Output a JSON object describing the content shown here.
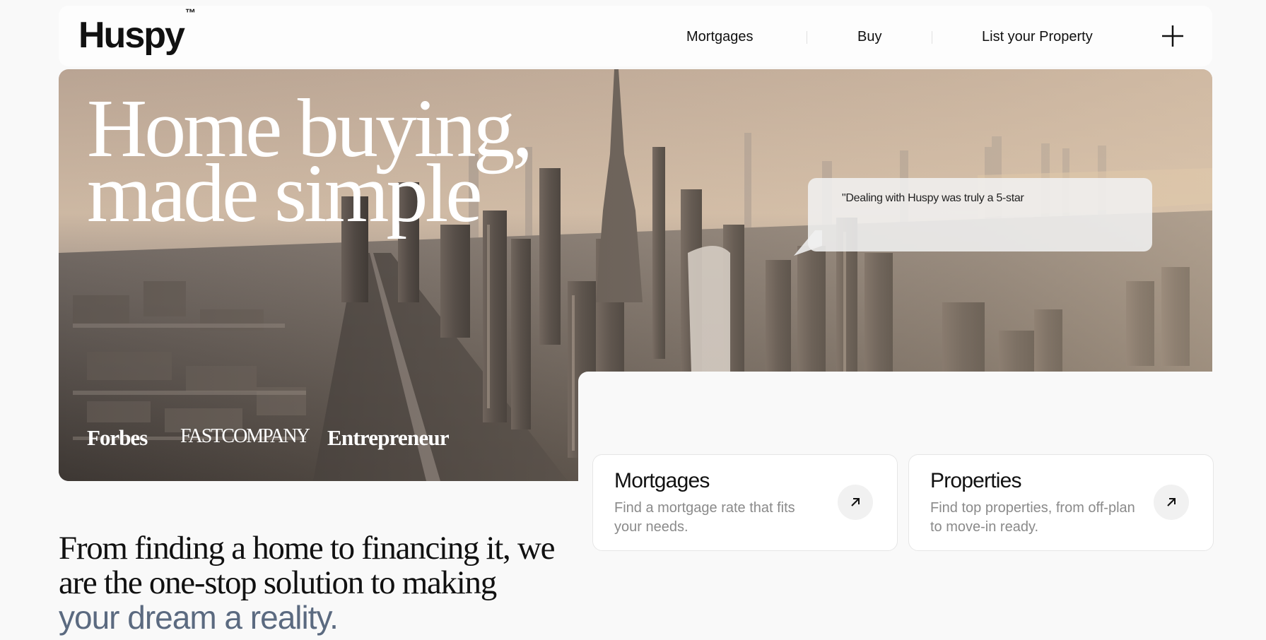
{
  "brand": {
    "name": "Huspy",
    "trademark": "™"
  },
  "nav": {
    "links": [
      {
        "label": "Mortgages"
      },
      {
        "label": "Buy"
      },
      {
        "label": "List your Property"
      }
    ],
    "menu_icon": "plus-icon"
  },
  "hero": {
    "headline_line1": "Home buying,",
    "headline_line2": "made simple",
    "press": [
      "Forbes",
      "FASTCOMPANY",
      "Entrepreneur"
    ],
    "testimonial": "\"Dealing with Huspy was truly a 5-star"
  },
  "cards": [
    {
      "title": "Mortgages",
      "description": "Find a mortgage rate that fits your needs.",
      "icon": "arrow-up-right-icon"
    },
    {
      "title": "Properties",
      "description": "Find top properties, from off-plan to move-in ready.",
      "icon": "arrow-up-right-icon"
    }
  ],
  "tagline": {
    "text": "From finding a home to financing it, we are the one-stop solution to making",
    "accent": "your dream a reality."
  },
  "colors": {
    "background": "#f9f9f9",
    "text": "#111111",
    "accent_text": "#5b6a80",
    "muted_text": "#8a8a8a"
  }
}
